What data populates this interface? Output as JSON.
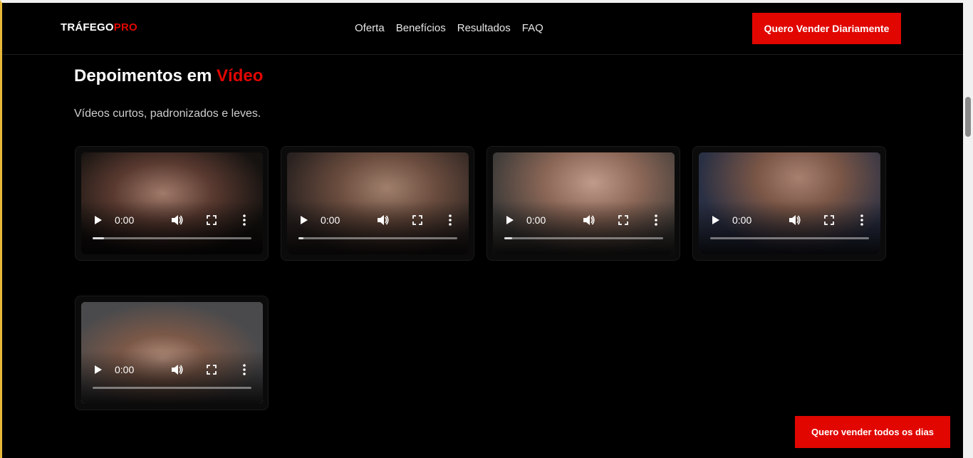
{
  "header": {
    "logo_main": "TRÁFEGO",
    "logo_accent": "PRO",
    "nav": [
      "Oferta",
      "Benefícios",
      "Resultados",
      "FAQ"
    ],
    "cta": "Quero Vender Diariamente"
  },
  "section": {
    "title_main": "Depoimentos em ",
    "title_accent": "Vídeo",
    "subtitle": "Vídeos curtos, padronizados e leves."
  },
  "videos": [
    {
      "time": "0:00",
      "progress": 0.07
    },
    {
      "time": "0:00",
      "progress": 0.03
    },
    {
      "time": "0:00",
      "progress": 0.05
    },
    {
      "time": "0:00",
      "progress": 0.0
    },
    {
      "time": "0:00",
      "progress": 0.0
    }
  ],
  "floating_cta": "Quero vender todos os dias",
  "colors": {
    "accent": "#e10600",
    "background": "#000000"
  },
  "icons": [
    "play-icon",
    "volume-icon",
    "fullscreen-icon",
    "more-icon"
  ]
}
